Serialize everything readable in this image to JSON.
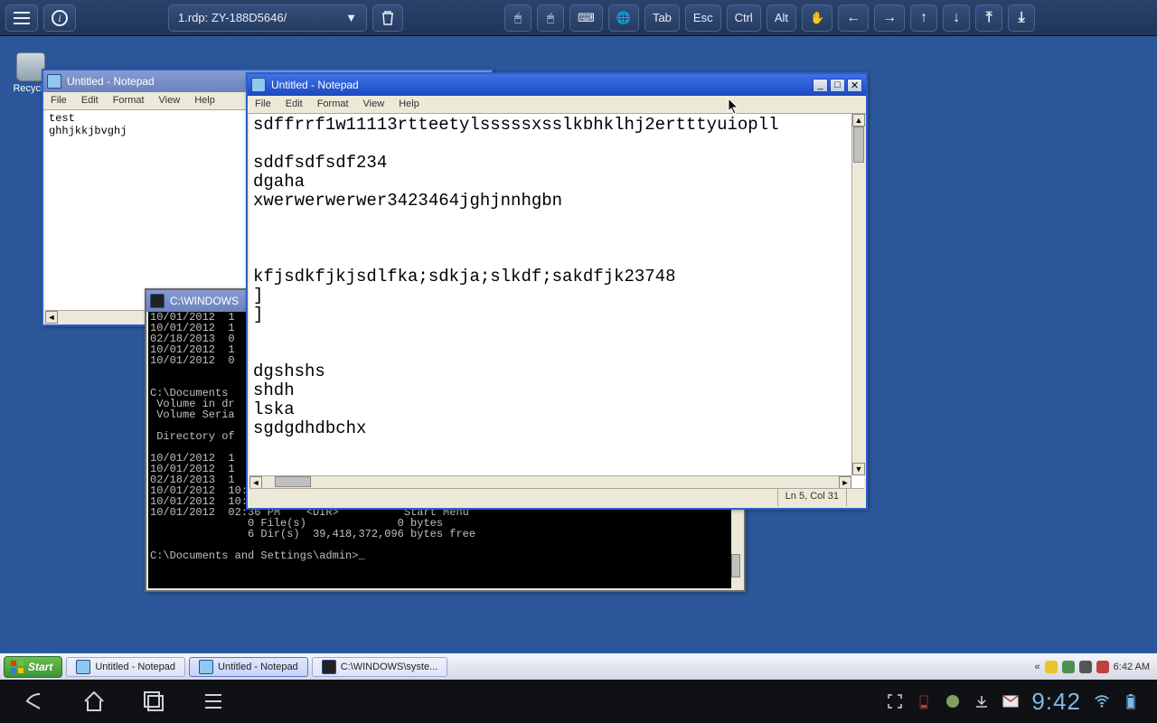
{
  "rdp": {
    "session_name": "1.rdp: ZY-188D5646/",
    "btn_labels": {
      "tab": "Tab",
      "esc": "Esc",
      "ctrl": "Ctrl",
      "alt": "Alt"
    }
  },
  "desktop_icons": {
    "recycle_bin": "Recycle"
  },
  "notepad_back": {
    "title": "Untitled - Notepad",
    "menu": [
      "File",
      "Edit",
      "Format",
      "View",
      "Help"
    ],
    "content": "test\nghhjkkjbvghj"
  },
  "cmd": {
    "title": "C:\\WINDOWS",
    "content": "10/01/2012  1\n10/01/2012  1\n02/18/2013  0\n10/01/2012  1\n10/01/2012  0\n\n\nC:\\Documents \n Volume in dr\n Volume Seria\n\n Directory of\n\n10/01/2012  1\n10/01/2012  1\n02/18/2013  1\n10/01/2012  10:01 PM    <DIR>          Favorites\n10/01/2012  10:01 PM    <DIR>          My Documents\n10/01/2012  02:36 PM    <DIR>          Start Menu\n               0 File(s)              0 bytes\n               6 Dir(s)  39,418,372,096 bytes free\n\nC:\\Documents and Settings\\admin>_"
  },
  "notepad_front": {
    "title": "Untitled - Notepad",
    "menu": [
      "File",
      "Edit",
      "Format",
      "View",
      "Help"
    ],
    "content": "sdffrrf1w11113rtteetylsssssxsslkbhklhj2ertttyuiopll\n\nsddfsdfsdf234\ndgaha\nxwerwerwerwer3423464jghjnnhgbn\n\n\n\nkfjsdkfjkjsdlfka;sdkja;slkdf;sakdfjk23748\n]\n]\n\n\ndgshshs\nshdh\nlska\nsgdgdhdbchx",
    "status": "Ln 5, Col 31"
  },
  "taskbar": {
    "start": "Start",
    "items": [
      "Untitled - Notepad",
      "Untitled - Notepad",
      "C:\\WINDOWS\\syste..."
    ],
    "clock": "6:42 AM",
    "arrow": "«"
  },
  "android": {
    "clock": "9:42"
  }
}
